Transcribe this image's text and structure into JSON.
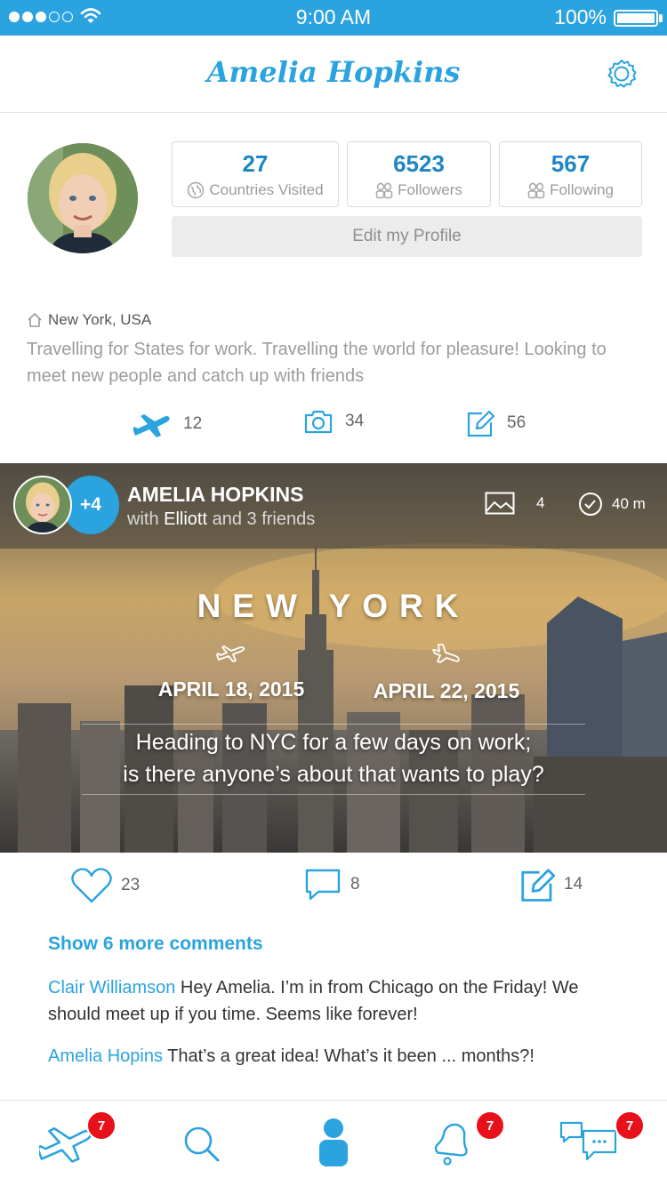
{
  "status_bar": {
    "time": "9:00 AM",
    "battery": "100%"
  },
  "header": {
    "title": "Amelia Hopkins"
  },
  "profile": {
    "stats": [
      {
        "value": "27",
        "label": "Countries Visited"
      },
      {
        "value": "6523",
        "label": "Followers"
      },
      {
        "value": "567",
        "label": "Following"
      }
    ],
    "edit_label": "Edit my Profile",
    "location": "New York, USA",
    "bio": "Travelling for States for work. Travelling the world for pleasure! Looking to meet new people and catch up with friends",
    "counts": {
      "trips": "12",
      "photos": "34",
      "posts": "56"
    }
  },
  "post": {
    "badge": "+4",
    "author": "AMELIA HOPKINS",
    "with_prefix": "with ",
    "with_name": "Elliott",
    "with_suffix": " and 3 friends",
    "images": "4",
    "time": "40 m",
    "city": "NEW YORK",
    "depart_date": "APRIL 18, 2015",
    "return_date": "APRIL 22, 2015",
    "text_line1": "Heading to NYC for a few days on work;",
    "text_line2": "is there anyone’s about that wants to play?",
    "likes": "23",
    "comments": "8",
    "edits": "14"
  },
  "comments": {
    "show_more": "Show 6 more comments",
    "items": [
      {
        "author": "Clair Williamson",
        "text": " Hey Amelia. I’m in from Chicago on the Friday! We should meet up if you time. Seems like forever!"
      },
      {
        "author": "Amelia Hopins",
        "text": " That’s a great idea! What’s it been ... months?!"
      }
    ]
  },
  "tabbar": {
    "badges": {
      "trips": "7",
      "notifications": "7",
      "messages": "7"
    }
  },
  "colors": {
    "accent": "#2aa3df",
    "badge": "#e8111a",
    "stat": "#1e86c4"
  },
  "icons": [
    "wifi-icon",
    "battery-icon",
    "gear-icon",
    "globe-icon",
    "followers-icon",
    "following-icon",
    "home-icon",
    "plane-icon",
    "camera-icon",
    "edit-icon",
    "image-icon",
    "clock-icon",
    "heart-icon",
    "comment-icon",
    "search-icon",
    "profile-icon",
    "bell-icon",
    "chat-icon"
  ]
}
